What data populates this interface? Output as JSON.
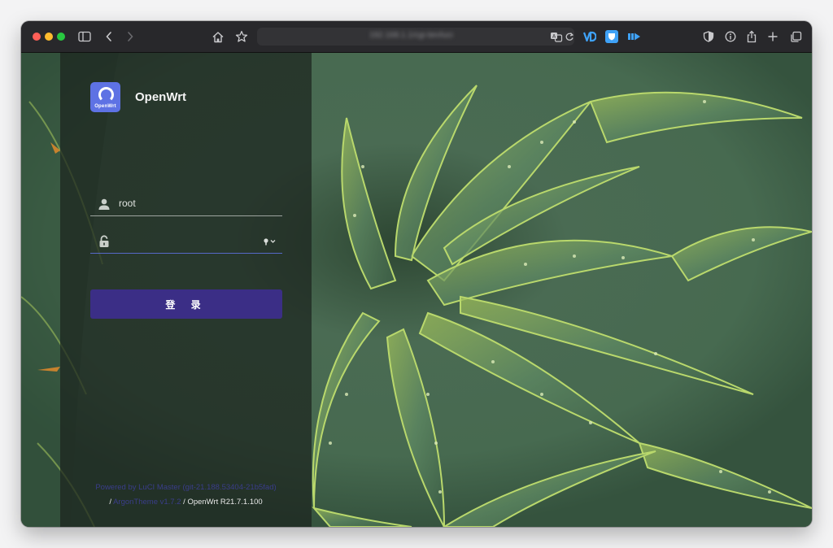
{
  "browser": {
    "url": "192.168.1.1/cgi-bin/luci",
    "toolbar_icons": [
      "sidebar-icon",
      "back-icon",
      "forward-icon",
      "home-icon",
      "bookmark-star-icon",
      "translate-icon",
      "reload-icon",
      "shield-icon",
      "info-icon",
      "share-icon",
      "new-tab-icon",
      "tab-overview-icon"
    ],
    "extensions": [
      "extension-vd-icon",
      "extension-shield-icon",
      "extension-video-icon"
    ]
  },
  "login": {
    "brand_title": "OpenWrt",
    "logo_text": "OpenWrt",
    "username_value": "root",
    "password_value": "",
    "submit_label": "登 录",
    "accent_color": "#5e72e4",
    "button_color": "#3b2e86"
  },
  "footer": {
    "powered_by": "Powered by LuCI Master (git-21.188.53404-21b5fad)",
    "separator_1": "/",
    "theme_link": "ArgonTheme v1.7.2",
    "separator_2": "/",
    "version": "OpenWrt R21.7.1.100"
  }
}
